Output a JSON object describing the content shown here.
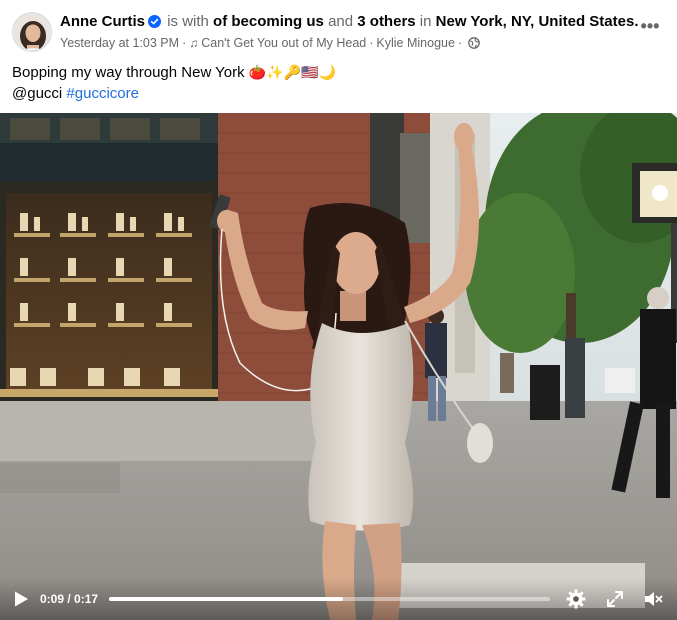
{
  "post": {
    "author": "Anne Curtis",
    "with_text": "is with",
    "tagged_first": "of becoming us",
    "and_text": "and",
    "tagged_others": "3 others",
    "in_text": "in",
    "location": "New York, NY, United States.",
    "timestamp": "Yesterday at 1:03 PM",
    "song": "Can't Get You out of My Head",
    "artist": "Kylie Minogue",
    "privacy_icon": "globe-icon",
    "verified_icon": "verified-badge-icon",
    "more_icon": "more-options-icon",
    "more_label": "•••"
  },
  "caption": {
    "line1": "Bopping my way through New York",
    "emojis": "🍅✨🔑🇺🇸🌙",
    "mention": "@gucci",
    "hashtag": "#guccicore"
  },
  "video": {
    "current_time": "0:09",
    "duration": "0:17",
    "time_label": "0:09 / 0:17",
    "progress_fraction": 0.53,
    "controls": {
      "play_icon": "play-icon",
      "settings_icon": "gear-icon",
      "fullscreen_icon": "fullscreen-icon",
      "mute_icon": "muted-speaker-icon"
    }
  },
  "colors": {
    "link": "#216fdb",
    "meta": "#65676b",
    "text": "#050505",
    "verified": "#0866ff"
  }
}
